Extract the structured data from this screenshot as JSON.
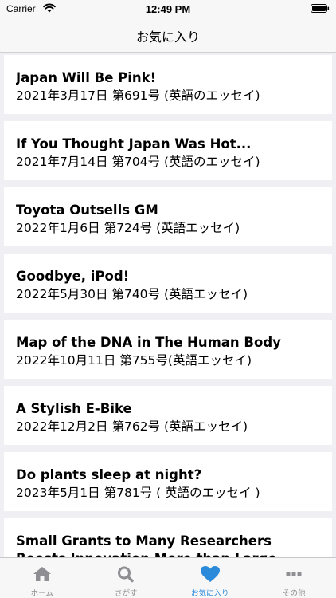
{
  "status_bar": {
    "carrier": "Carrier",
    "time": "12:49 PM"
  },
  "nav": {
    "title": "お気に入り"
  },
  "favorites": [
    {
      "title": "Japan Will Be Pink!",
      "subtitle": "2021年3月17日 第691号 (英語のエッセイ)"
    },
    {
      "title": "If You Thought Japan Was Hot...",
      "subtitle": "2021年7月14日 第704号 (英語のエッセイ)"
    },
    {
      "title": "Toyota Outsells GM",
      "subtitle": "2022年1月6日 第724号 (英語エッセイ)"
    },
    {
      "title": "Goodbye, iPod!",
      "subtitle": "2022年5月30日 第740号 (英語エッセイ)"
    },
    {
      "title": "Map of the DNA in The Human Body",
      "subtitle": "2022年10月11日 第755号(英語エッセイ)"
    },
    {
      "title": "A Stylish E-Bike",
      "subtitle": "2022年12月2日 第762号 (英語エッセイ)"
    },
    {
      "title": "Do plants sleep at night?",
      "subtitle": "2023年5月1日 第781号 ( 英語のエッセイ )"
    },
    {
      "title": "Small Grants to Many Researchers Boosts Innovation More than Large Funds to Few",
      "subtitle": ""
    }
  ],
  "tabs": [
    {
      "label": "ホーム",
      "icon": "house-icon",
      "active": false
    },
    {
      "label": "さがす",
      "icon": "magnifier-icon",
      "active": false
    },
    {
      "label": "お気に入り",
      "icon": "heart-icon",
      "active": true
    },
    {
      "label": "その他",
      "icon": "ellipsis-icon",
      "active": false
    }
  ],
  "colors": {
    "accent": "#2b8ad9",
    "inactive": "#8e8e93",
    "background": "#efeff4"
  }
}
